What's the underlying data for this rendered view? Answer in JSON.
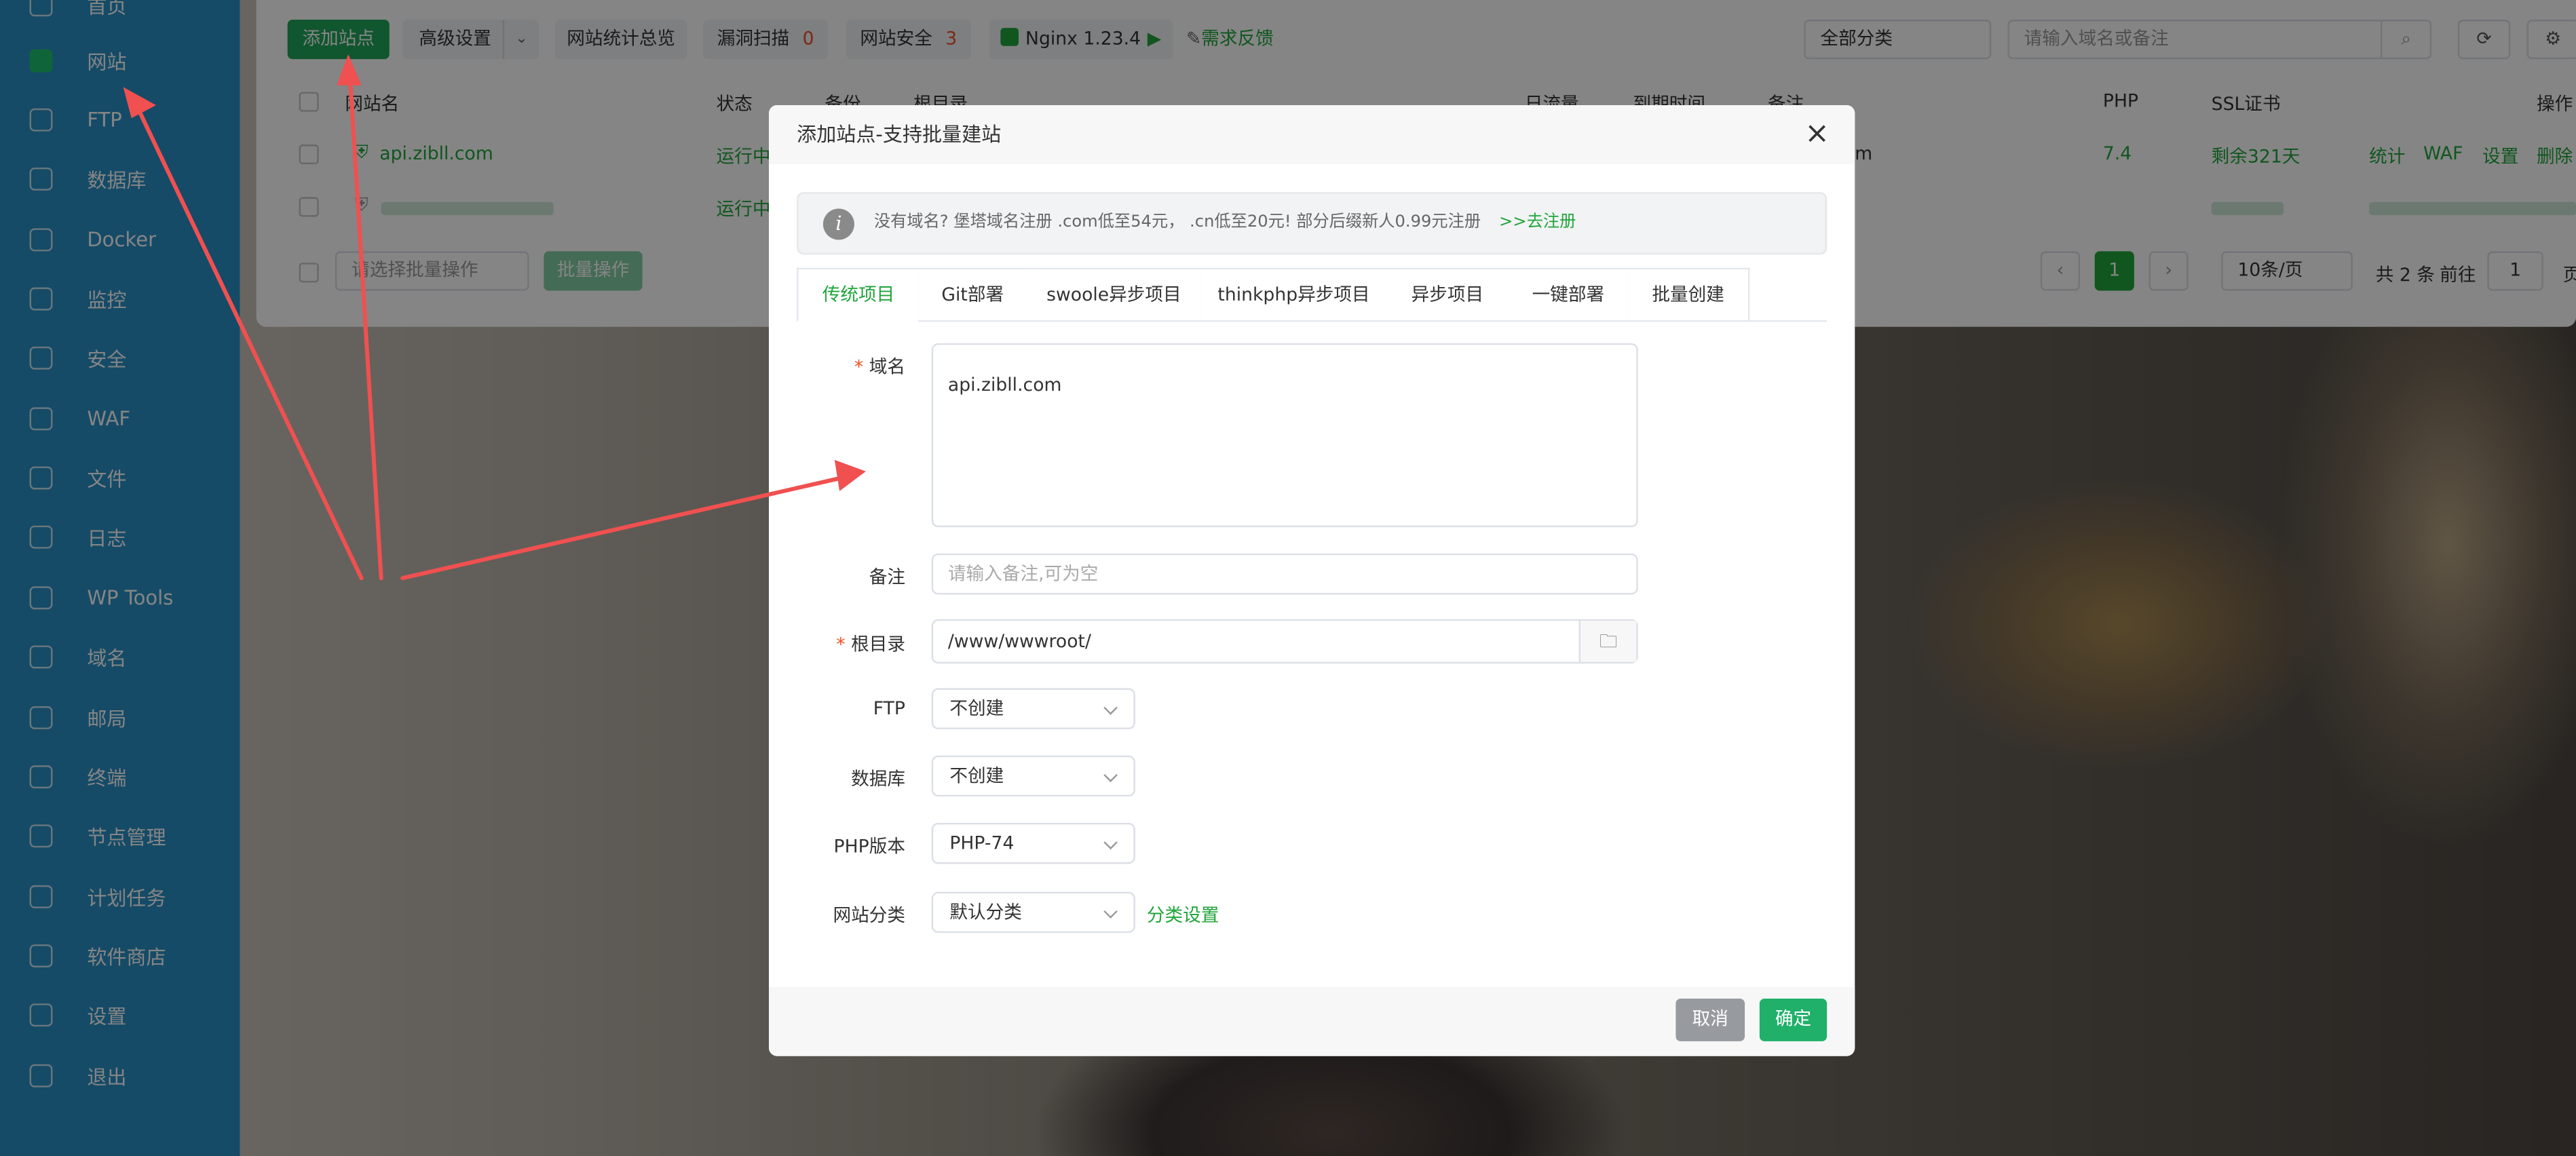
{
  "sidebar": {
    "items": [
      {
        "label": "首页"
      },
      {
        "label": "网站",
        "active": true
      },
      {
        "label": "FTP"
      },
      {
        "label": "数据库"
      },
      {
        "label": "Docker"
      },
      {
        "label": "监控"
      },
      {
        "label": "安全"
      },
      {
        "label": "WAF"
      },
      {
        "label": "文件"
      },
      {
        "label": "日志"
      },
      {
        "label": "WP Tools"
      },
      {
        "label": "域名"
      },
      {
        "label": "邮局"
      },
      {
        "label": "终端"
      },
      {
        "label": "节点管理"
      },
      {
        "label": "计划任务"
      },
      {
        "label": "软件商店"
      },
      {
        "label": "设置"
      },
      {
        "label": "退出"
      }
    ]
  },
  "toolbar": {
    "add_site": "添加站点",
    "advanced": "高级设置",
    "stats_overview": "网站统计总览",
    "vuln_scan": "漏洞扫描",
    "vuln_count": "0",
    "site_security": "网站安全",
    "security_count": "3",
    "nginx": "Nginx 1.23.4",
    "feedback": "需求反馈",
    "category": "全部分类",
    "search_placeholder": "请输入域名或备注"
  },
  "table": {
    "headers": {
      "name": "网站名",
      "status": "状态",
      "backup": "备份",
      "root": "根目录",
      "traffic": "日流量",
      "expire": "到期时间",
      "note": "备注",
      "php": "PHP",
      "ssl": "SSL证书",
      "ops": "操作"
    },
    "row1": {
      "name": "api.zibll.com",
      "status": "运行中",
      "note_tail": "m",
      "php": "7.4",
      "ssl": "剩余321天",
      "op_stats": "统计",
      "op_waf": "WAF",
      "op_settings": "设置",
      "op_delete": "删除"
    },
    "row2": {
      "status": "运行中"
    },
    "batch_placeholder": "请选择批量操作",
    "batch_button": "批量操作"
  },
  "pagination": {
    "page": "1",
    "page_size": "10条/页",
    "total": "共 2 条",
    "goto": "前往",
    "goto_value": "1",
    "page_suffix": "页"
  },
  "modal": {
    "title": "添加站点-支持批量建站",
    "tip": "没有域名? 堡塔域名注册 .com低至54元， .cn低至20元! 部分后缀新人0.99元注册",
    "tip_link": ">>去注册",
    "tabs": [
      "传统项目",
      "Git部署",
      "swoole异步项目",
      "thinkphp异步项目",
      "异步项目",
      "一键部署",
      "批量创建"
    ],
    "domain_label": "域名",
    "domain_value": "api.zibll.com",
    "remark_label": "备注",
    "remark_placeholder": "请输入备注,可为空",
    "root_label": "根目录",
    "root_value": "/www/wwwroot/",
    "ftp_label": "FTP",
    "ftp_value": "不创建",
    "db_label": "数据库",
    "db_value": "不创建",
    "php_label": "PHP版本",
    "php_value": "PHP-74",
    "category_label": "网站分类",
    "category_value": "默认分类",
    "category_link": "分类设置",
    "cancel": "取消",
    "confirm": "确定"
  },
  "colors": {
    "accent": "#20a53a",
    "sidebar": "#2a90c6",
    "arrow": "#f05050"
  }
}
